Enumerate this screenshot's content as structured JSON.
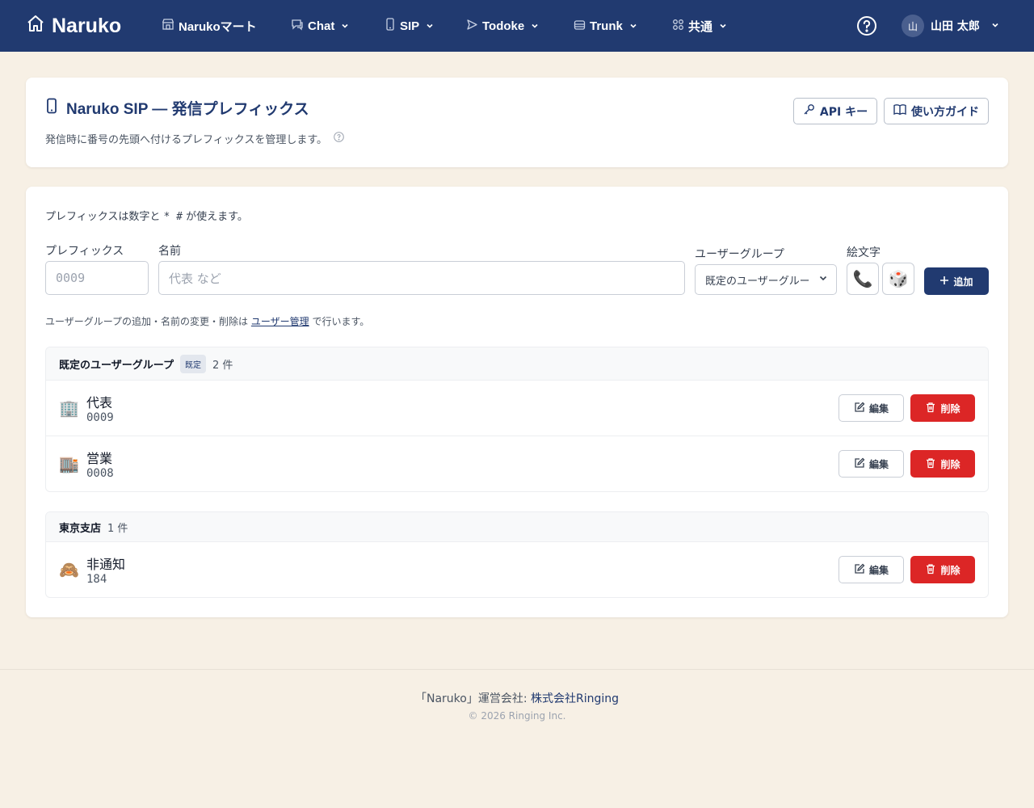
{
  "nav": {
    "brand": "Naruko",
    "items": [
      {
        "label": "Narukoマート"
      },
      {
        "label": "Chat"
      },
      {
        "label": "SIP"
      },
      {
        "label": "Todoke"
      },
      {
        "label": "Trunk"
      },
      {
        "label": "共通"
      }
    ],
    "user": {
      "initial": "山",
      "name": "山田 太郎"
    }
  },
  "header": {
    "title": "Naruko SIP — 発信プレフィックス",
    "subtitle": "発信時に番号の先頭へ付けるプレフィックスを管理します。",
    "api_key_label": "API キー",
    "guide_label": "使い方ガイド"
  },
  "form": {
    "hint_prefix": "プレフィックスは数字と",
    "hint_symbols": "* #",
    "hint_suffix": "が使えます。",
    "prefix_label": "プレフィックス",
    "prefix_placeholder": "0009",
    "name_label": "名前",
    "name_placeholder": "代表 など",
    "group_label": "ユーザーグループ",
    "group_selected": "既定のユーザーグループ",
    "emoji_label": "絵文字",
    "emoji_phone": "📞",
    "emoji_dice": "🎲",
    "add_label": "追加",
    "note_before": "ユーザーグループの追加・名前の変更・削除は",
    "note_link": "ユーザー管理",
    "note_after": "で行います。"
  },
  "groups": [
    {
      "name": "既定のユーザーグループ",
      "badge": "既定",
      "count": "2 件",
      "rows": [
        {
          "emoji": "🏢",
          "name": "代表",
          "prefix": "0009",
          "edit": "編集",
          "delete": "削除"
        },
        {
          "emoji": "🏬",
          "name": "営業",
          "prefix": "0008",
          "edit": "編集",
          "delete": "削除"
        }
      ]
    },
    {
      "name": "東京支店",
      "count": "1 件",
      "rows": [
        {
          "emoji": "🙈",
          "name": "非通知",
          "prefix": "184",
          "edit": "編集",
          "delete": "削除"
        }
      ]
    }
  ],
  "footer": {
    "line1_before": "「Naruko」運営会社:",
    "company": "株式会社Ringing",
    "copyright": "© 2026 Ringing Inc."
  },
  "colors": {
    "nav_bg": "#213a70",
    "page_bg": "#f7f0e5",
    "danger": "#dc2626",
    "primary": "#213a70"
  }
}
